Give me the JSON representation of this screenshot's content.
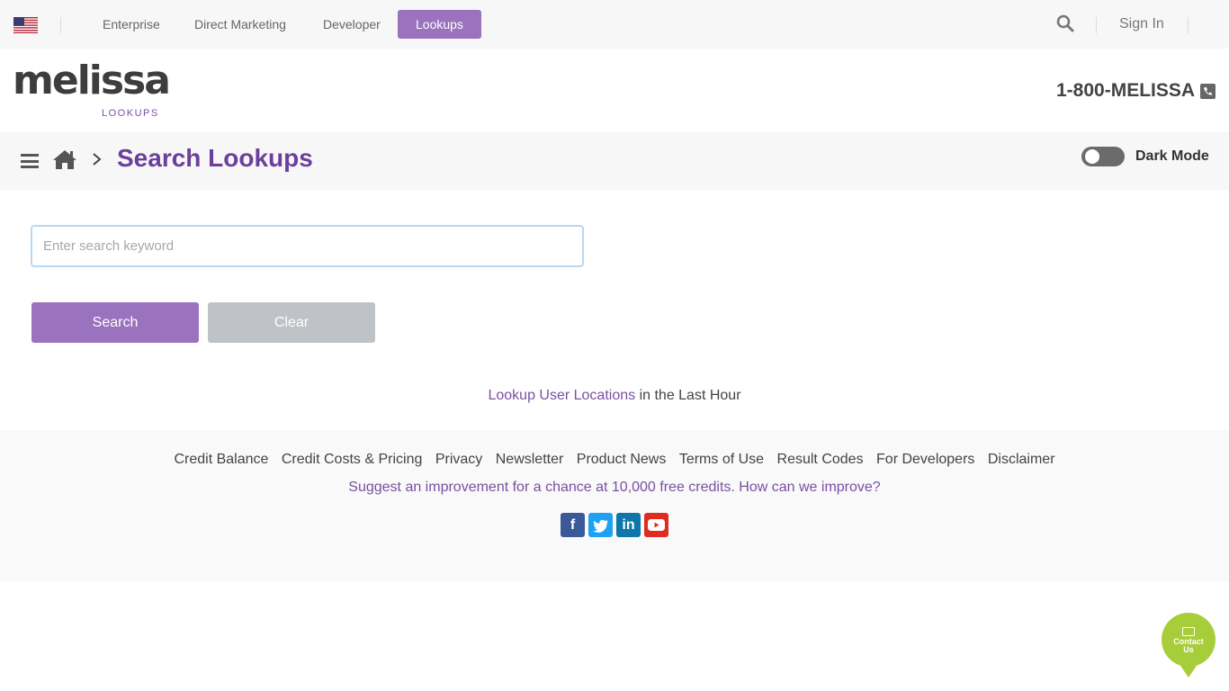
{
  "topnav": {
    "items": [
      {
        "label": "Enterprise"
      },
      {
        "label": "Direct Marketing"
      },
      {
        "label": "Developer"
      },
      {
        "label": "Lookups"
      }
    ],
    "active": "Lookups",
    "signin_label": "Sign In",
    "flag_icon": "us-flag-icon",
    "search_icon": "search-icon"
  },
  "header": {
    "logo_text": "melissa",
    "logo_sub": "LOOKUPS",
    "phone": "1-800-MELISSA",
    "phone_icon": "phone-icon"
  },
  "breadcrumb": {
    "title": "Search Lookups",
    "dark_mode_label": "Dark Mode",
    "dark_mode_on": false
  },
  "search": {
    "placeholder": "Enter search keyword",
    "value": "",
    "search_label": "Search",
    "clear_label": "Clear"
  },
  "locations": {
    "link_text": "Lookup User Locations",
    "suffix": " in the Last Hour"
  },
  "footer": {
    "links": [
      "Credit Balance",
      "Credit Costs & Pricing",
      "Privacy",
      "Newsletter",
      "Product News",
      "Terms of Use",
      "Result Codes",
      "For Developers",
      "Disclaimer"
    ],
    "suggest": "Suggest an improvement for a chance at 10,000 free credits. How can we improve?",
    "social": [
      "facebook-icon",
      "twitter-icon",
      "linkedin-icon",
      "youtube-icon"
    ]
  },
  "contact": {
    "label_line1": "Contact",
    "label_line2": "Us"
  },
  "colors": {
    "accent": "#9a72bd",
    "title_purple": "#6b3f9b",
    "contact_green": "#a8cd3a"
  }
}
